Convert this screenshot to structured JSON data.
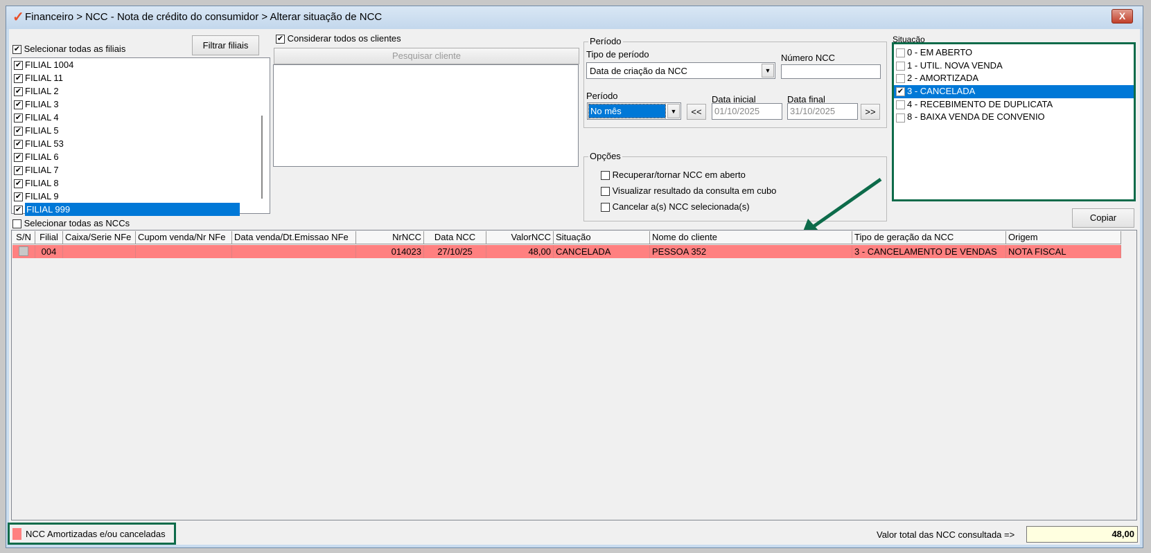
{
  "window": {
    "title": "Financeiro > NCC - Nota de crédito do consumidor > Alterar situação de NCC",
    "close": "X"
  },
  "filiais": {
    "select_all_label": "Selecionar todas as filiais",
    "select_all_checked": true,
    "filter_button": "Filtrar filiais",
    "items": [
      {
        "label": "FILIAL 1004"
      },
      {
        "label": "FILIAL 11"
      },
      {
        "label": "FILIAL 2"
      },
      {
        "label": "FILIAL 3"
      },
      {
        "label": "FILIAL 4"
      },
      {
        "label": "FILIAL 5"
      },
      {
        "label": "FILIAL 53"
      },
      {
        "label": "FILIAL 6"
      },
      {
        "label": "FILIAL 7"
      },
      {
        "label": "FILIAL 8"
      },
      {
        "label": "FILIAL 9"
      },
      {
        "label": "FILIAL 999"
      }
    ],
    "selected_index": 11
  },
  "clientes": {
    "consider_all_label": "Considerar todos os clientes",
    "consider_all_checked": true,
    "search_button": "Pesquisar cliente"
  },
  "periodo": {
    "group_label": "Período",
    "tipo_label": "Tipo de período",
    "tipo_value": "Data de criação da NCC",
    "numero_label": "Número NCC",
    "numero_value": "",
    "periodo_label": "Período",
    "periodo_value": "No mês",
    "prev": "<<",
    "next": ">>",
    "data_inicial_label": "Data inicial",
    "data_inicial": "01/10/2025",
    "data_final_label": "Data final",
    "data_final": "31/10/2025"
  },
  "opcoes": {
    "group_label": "Opções",
    "items": [
      {
        "label": "Recuperar/tornar NCC em aberto",
        "checked": false
      },
      {
        "label": "Visualizar resultado da consulta em cubo",
        "checked": false
      },
      {
        "label": "Cancelar a(s) NCC selecionada(s)",
        "checked": false
      }
    ]
  },
  "situacao": {
    "label": "Situação",
    "items": [
      {
        "label": "0 - EM ABERTO",
        "checked": false
      },
      {
        "label": "1 - UTIL. NOVA VENDA",
        "checked": false
      },
      {
        "label": "2 - AMORTIZADA",
        "checked": false
      },
      {
        "label": "3 - CANCELADA",
        "checked": true
      },
      {
        "label": "4 - RECEBIMENTO DE DUPLICATA",
        "checked": false
      },
      {
        "label": "8 - BAIXA VENDA DE CONVENIO",
        "checked": false
      }
    ]
  },
  "copy_button": "Copiar",
  "select_all_ncc_label": "Selecionar todas as NCCs",
  "grid": {
    "columns": [
      "S/N",
      "Filial",
      "Caixa/Serie NFe",
      "Cupom venda/Nr NFe",
      "Data venda/Dt.Emissao NFe",
      "NrNCC",
      "Data NCC",
      "ValorNCC",
      "Situação",
      "Nome do cliente",
      "Tipo de geração da NCC",
      "Origem"
    ],
    "rows": [
      [
        "",
        "004",
        "",
        "",
        "",
        "014023",
        "27/10/25",
        "48,00",
        "CANCELADA",
        "PESSOA 352",
        "3 - CANCELAMENTO DE VENDAS",
        "NOTA FISCAL"
      ]
    ]
  },
  "legend": {
    "label": "NCC Amortizadas e/ou canceladas",
    "color": "#ff8080"
  },
  "total": {
    "label": "Valor total das NCC consultada =>",
    "value": "48,00"
  },
  "colors": {
    "highlight": "#0078d7",
    "annotation": "#0d6b4a",
    "row": "#ff8080"
  }
}
